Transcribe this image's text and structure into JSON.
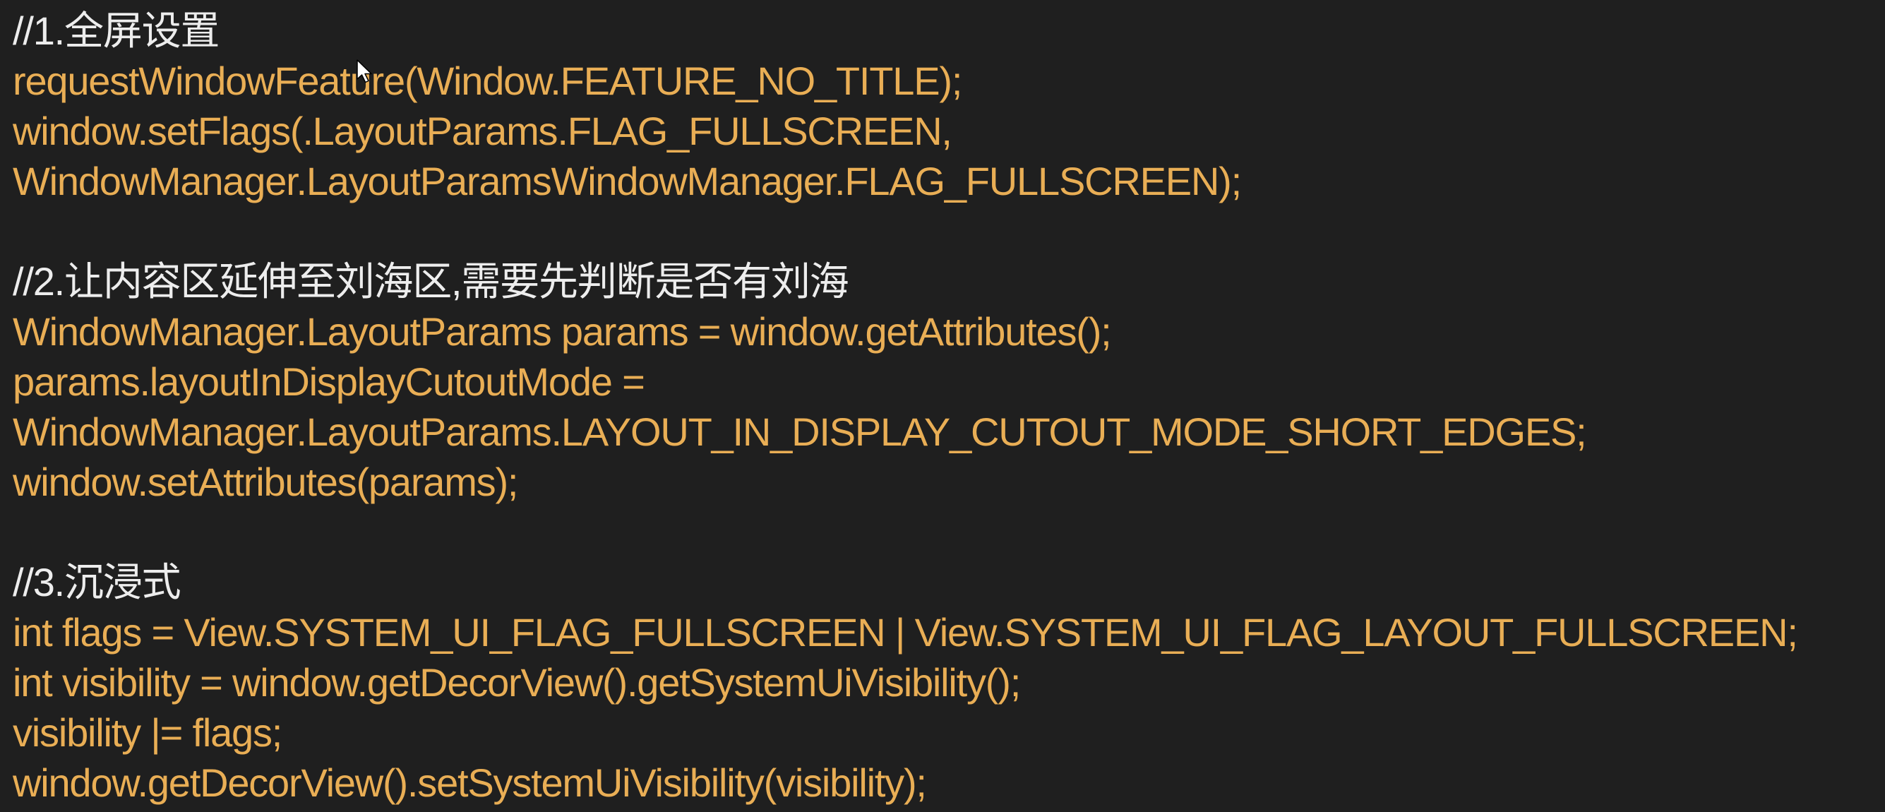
{
  "editor": {
    "lines": [
      {
        "kind": "comment",
        "text": "//1.全屏设置"
      },
      {
        "kind": "code",
        "text": "requestWindowFeature(Window.FEATURE_NO_TITLE);"
      },
      {
        "kind": "code",
        "text": "window.setFlags(.LayoutParams.FLAG_FULLSCREEN,"
      },
      {
        "kind": "code",
        "text": "WindowManager.LayoutParamsWindowManager.FLAG_FULLSCREEN);"
      },
      {
        "kind": "blank",
        "text": ""
      },
      {
        "kind": "comment",
        "text": "//2.让内容区延伸至刘海区,需要先判断是否有刘海"
      },
      {
        "kind": "code",
        "text": "WindowManager.LayoutParams params = window.getAttributes();"
      },
      {
        "kind": "code",
        "text": "params.layoutInDisplayCutoutMode ="
      },
      {
        "kind": "code",
        "text": "WindowManager.LayoutParams.LAYOUT_IN_DISPLAY_CUTOUT_MODE_SHORT_EDGES;"
      },
      {
        "kind": "code",
        "text": "window.setAttributes(params);"
      },
      {
        "kind": "blank",
        "text": ""
      },
      {
        "kind": "comment",
        "text": "//3.沉浸式"
      },
      {
        "kind": "code",
        "text": "int flags = View.SYSTEM_UI_FLAG_FULLSCREEN | View.SYSTEM_UI_FLAG_LAYOUT_FULLSCREEN;"
      },
      {
        "kind": "code",
        "text": "int visibility = window.getDecorView().getSystemUiVisibility();"
      },
      {
        "kind": "code",
        "text": "visibility |= flags;"
      },
      {
        "kind": "code",
        "text": "window.getDecorView().setSystemUiVisibility(visibility);"
      }
    ]
  },
  "colors": {
    "background": "#1f1f1f",
    "comment_text": "#ededed",
    "code_text": "#e9ae55"
  },
  "icons": {
    "cursor": "mouse-pointer-icon"
  }
}
